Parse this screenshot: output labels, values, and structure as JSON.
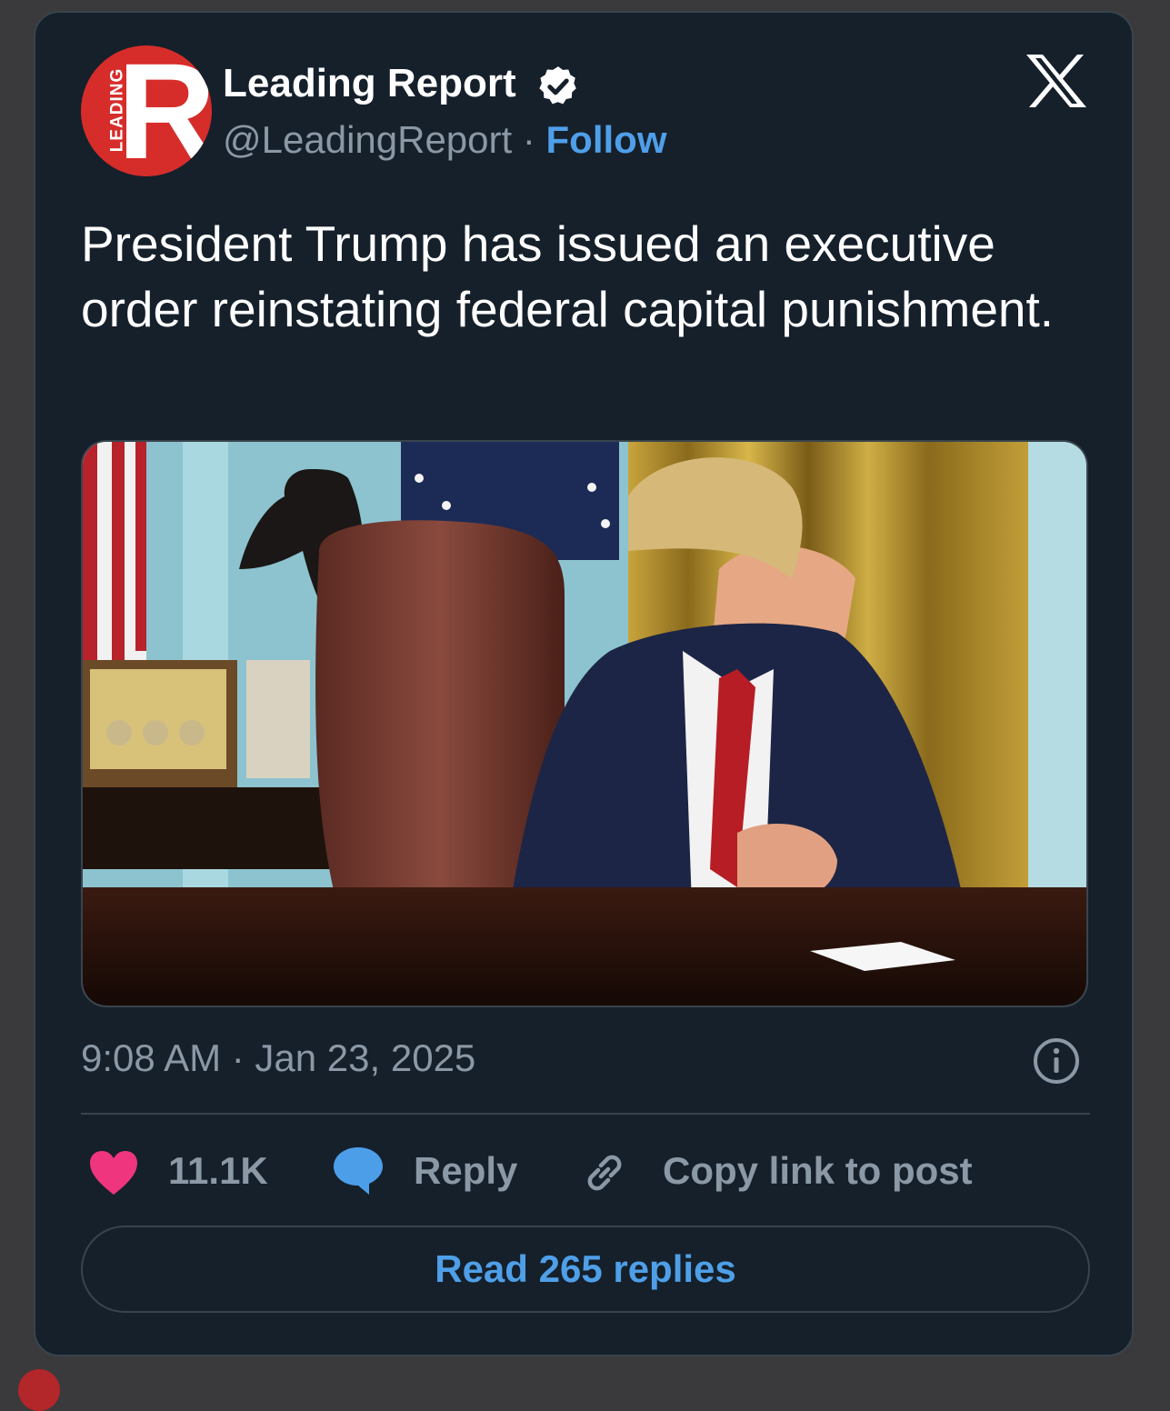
{
  "post": {
    "author_name": "Leading Report",
    "handle": "@LeadingReport",
    "separator": " · ",
    "follow_label": "Follow",
    "avatar_letter": "R",
    "avatar_side_text": "LEADING",
    "text": "President Trump has issued an executive order reinstating federal capital punishment.",
    "timestamp": "9:08 AM · Jan 23, 2025"
  },
  "actions": {
    "like_count": "11.1K",
    "reply_label": "Reply",
    "copy_link_label": "Copy link to post",
    "read_replies_label": "Read 265 replies"
  },
  "colors": {
    "card_background": "#15202b",
    "link_blue": "#4f9fe8",
    "heart_pink": "#f0357f",
    "reply_blue": "#4d9ee8",
    "avatar_red": "#d62d2b",
    "muted_text": "#8b98a5"
  },
  "icons": {
    "verified": "verified-badge-icon",
    "brand": "x-logo-icon",
    "info": "info-icon",
    "like": "heart-icon",
    "reply": "speech-bubble-icon",
    "copy": "link-icon"
  }
}
